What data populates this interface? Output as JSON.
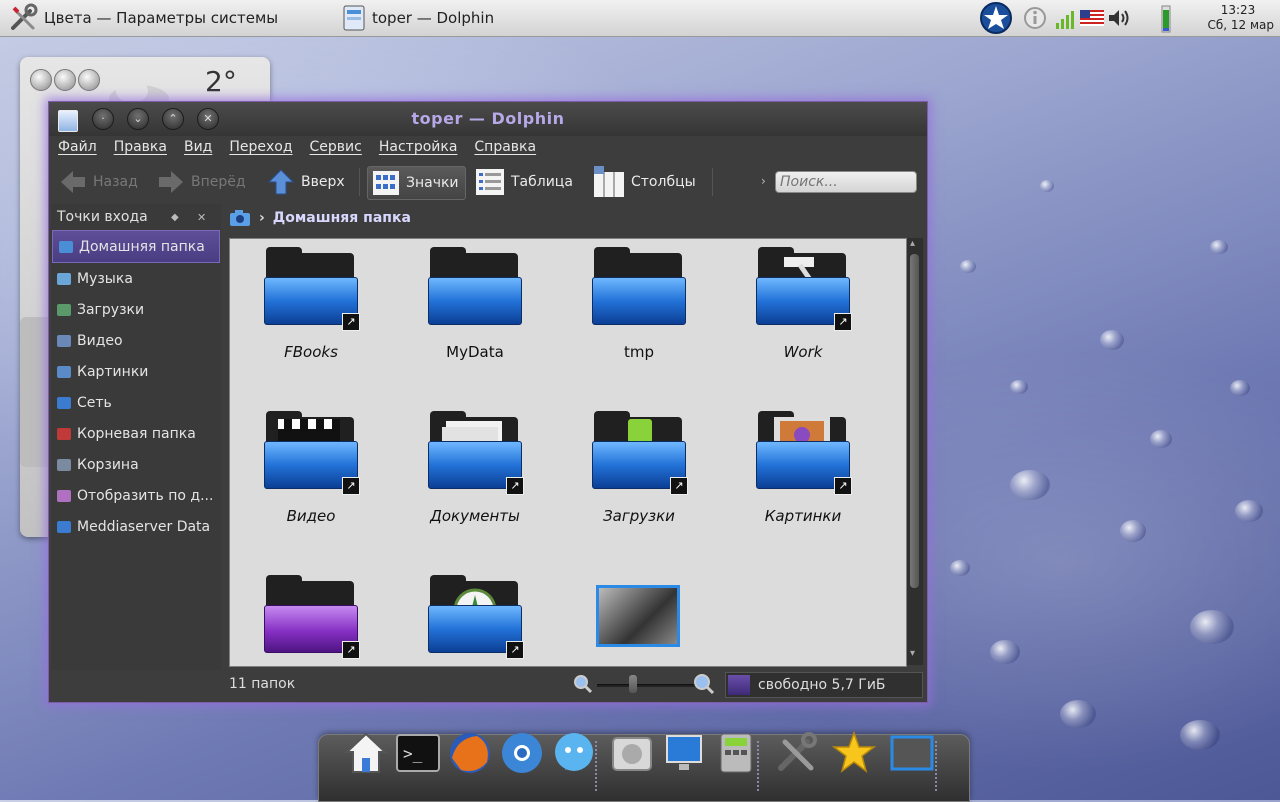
{
  "panel": {
    "task1": {
      "title": "Цвета — Параметры системы",
      "icon": "tools-icon"
    },
    "task2": {
      "title": "toper — Dolphin",
      "icon": "dolphin-icon"
    },
    "clock": {
      "time": "13:23",
      "date": "Сб, 12 мар"
    },
    "tray_icons": [
      "kde-star-icon",
      "info-icon",
      "network-signal-icon",
      "us-flag-icon",
      "volume-icon",
      "battery-icon"
    ]
  },
  "weather": {
    "temperature": "2°"
  },
  "window": {
    "title": "toper — Dolphin",
    "menu": [
      "Файл",
      "Правка",
      "Вид",
      "Переход",
      "Сервис",
      "Настройка",
      "Справка"
    ],
    "toolbar": {
      "back": "Назад",
      "forward": "Вперёд",
      "up": "Вверх",
      "icons": "Значки",
      "details": "Таблица",
      "columns": "Столбцы"
    },
    "search": {
      "placeholder": "Поиск..."
    },
    "places": {
      "title": "Точки входа",
      "items": [
        {
          "label": "Домашняя папка",
          "selected": true,
          "color": "#4a8fd6"
        },
        {
          "label": "Музыка",
          "color": "#6aa6d8"
        },
        {
          "label": "Загрузки",
          "color": "#5a9a6a"
        },
        {
          "label": "Видео",
          "color": "#6a88b8"
        },
        {
          "label": "Картинки",
          "color": "#5a8ac8"
        },
        {
          "label": "Сеть",
          "color": "#3b7bd0"
        },
        {
          "label": "Корневая папка",
          "color": "#c03a3a"
        },
        {
          "label": "Корзина",
          "color": "#7a8aa0"
        },
        {
          "label": "Отобразить по д...",
          "color": "#b070c0"
        },
        {
          "label": "Meddiaserver Data",
          "color": "#3b7bd0"
        }
      ]
    },
    "breadcrumb": {
      "location": "Домашняя папка"
    },
    "files": [
      {
        "name": "FBooks",
        "italic": true,
        "symlink": true,
        "emblem": ""
      },
      {
        "name": "MyData",
        "italic": false,
        "symlink": false,
        "emblem": ""
      },
      {
        "name": "tmp",
        "italic": false,
        "symlink": false,
        "emblem": ""
      },
      {
        "name": "Work",
        "italic": true,
        "symlink": true,
        "emblem": "hammer"
      },
      {
        "name": "Видео",
        "italic": true,
        "symlink": true,
        "emblem": "clapper"
      },
      {
        "name": "Документы",
        "italic": true,
        "symlink": true,
        "emblem": "documents"
      },
      {
        "name": "Загрузки",
        "italic": true,
        "symlink": true,
        "emblem": "download"
      },
      {
        "name": "Картинки",
        "italic": true,
        "symlink": true,
        "emblem": "pictures"
      },
      {
        "name": "",
        "italic": true,
        "symlink": true,
        "emblem": "purple"
      },
      {
        "name": "",
        "italic": true,
        "symlink": true,
        "emblem": "music"
      },
      {
        "name": "",
        "italic": false,
        "symlink": false,
        "emblem": "screenshot"
      }
    ],
    "status": {
      "count": "11 папок",
      "free_space": "свободно 5,7 ГиБ"
    }
  },
  "dock": [
    "home-icon",
    "terminal-icon",
    "firefox-icon",
    "chrome-icon",
    "chat-icon",
    "disk-icon",
    "network-monitor-icon",
    "calculator-icon",
    "settings-tools-icon",
    "favorites-star-icon",
    "screenshot-icon"
  ]
}
